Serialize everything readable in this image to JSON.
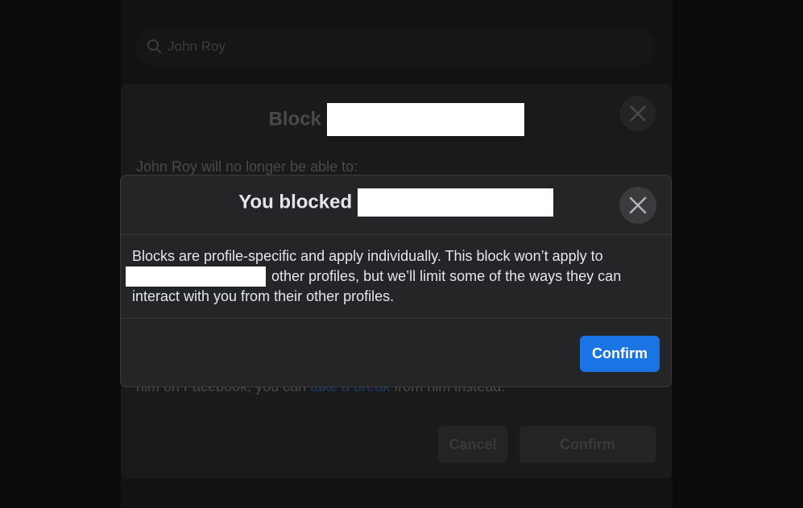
{
  "background": {
    "search": {
      "value": "John Roy"
    },
    "right_column_text": [
      "",
      "",
      "",
      "",
      ""
    ]
  },
  "block_dialog": {
    "title": "Block",
    "subtitle": "John Roy will no longer be able to:",
    "note_prefix": "him on Facebook, you can ",
    "note_link": "take a break",
    "note_suffix": " from him instead.",
    "cancel_label": "Cancel",
    "confirm_label": "Confirm"
  },
  "dialog": {
    "title": "You blocked",
    "body_line_1": "Blocks are profile-specific and apply individually. This block won’t apply to",
    "body_line_2": "other profiles, but we’ll limit some of the ways they can",
    "body_line_3": "interact with you from their other profiles.",
    "confirm_label": "Confirm"
  },
  "colors": {
    "dialog_bg": "#242526",
    "accent": "#1b74e4",
    "text_primary": "#e4e6eb",
    "close_button_bg": "#3a3b3c"
  },
  "icons": {
    "close": "close-icon",
    "search": "search-icon"
  }
}
